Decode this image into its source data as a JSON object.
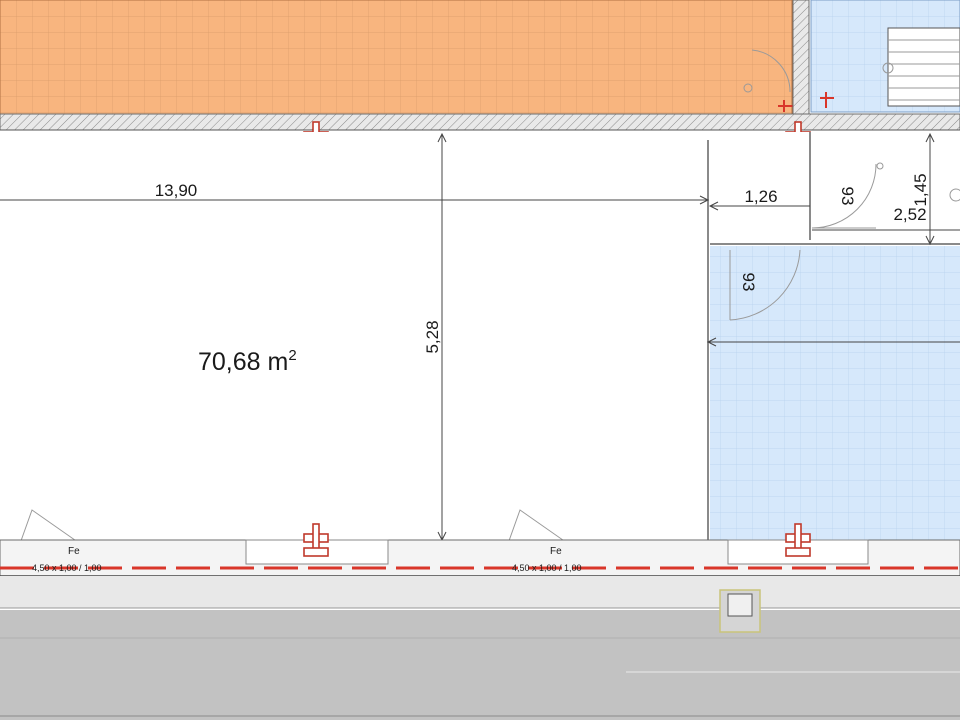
{
  "plan": {
    "area_label": "70,68 m",
    "area_superscript": "2",
    "dimensions": {
      "width_main": "13,90",
      "height_main": "5,28",
      "corridor_width": "1,26",
      "door_1": "93",
      "door_2": "93",
      "room_height": "1,45",
      "room_width": "2,52"
    },
    "windows": [
      {
        "type": "Fe",
        "size": "4,50 x 1,00 / 1,00"
      },
      {
        "type": "Fe",
        "size": "4,50 x 1,00 / 1,00"
      }
    ],
    "colors": {
      "orange_room": "#f8b57f",
      "blue_room": "#d6e8fb",
      "grid_orange": "#d99b6a",
      "grid_blue": "#b7d1ee",
      "steel_red": "#c0392b",
      "street_gray": "#c2c2c2"
    }
  }
}
